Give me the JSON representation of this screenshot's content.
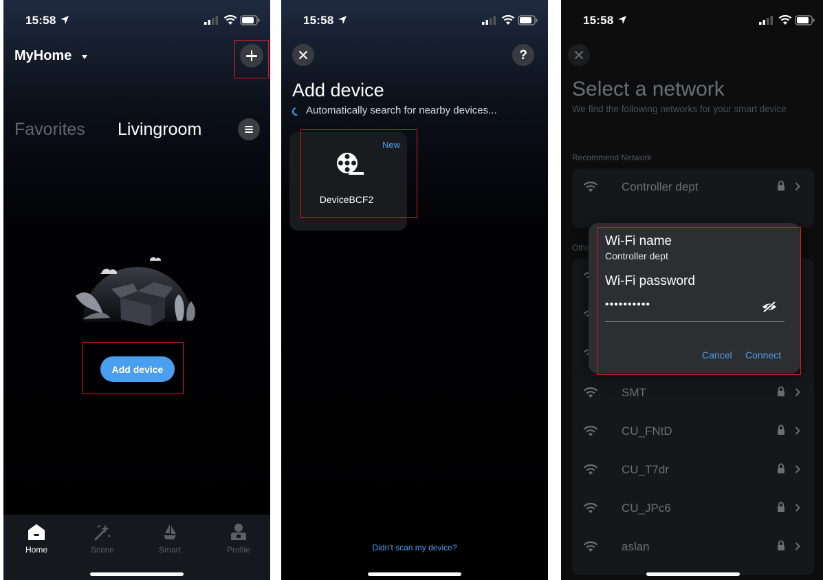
{
  "status": {
    "time": "15:58"
  },
  "home": {
    "title": "MyHome",
    "tabs": {
      "favorites": "Favorites",
      "room": "Livingroom"
    },
    "add_device_label": "Add device",
    "tabbar": [
      {
        "label": "Home",
        "icon": "home-icon"
      },
      {
        "label": "Scene",
        "icon": "magic-wand-icon"
      },
      {
        "label": "Smart",
        "icon": "smart-shapes-icon"
      },
      {
        "label": "Profile",
        "icon": "profile-icon"
      }
    ]
  },
  "add_device": {
    "title": "Add device",
    "searching": "Automatically search for nearby devices...",
    "help": "?",
    "device": {
      "badge": "New",
      "name": "DeviceBCF2",
      "icon": "film-reel-icon"
    },
    "link": "Didn't scan my device?"
  },
  "network": {
    "title": "Select a network",
    "subtitle": "We find the following networks for your smart device",
    "recommend_label": "Recommend Network",
    "others_label": "Othe",
    "recommended": [
      {
        "name": "Controller dept"
      }
    ],
    "others": [
      {
        "name": "SMT"
      },
      {
        "name": "CU_FNtD"
      },
      {
        "name": "CU_T7dr"
      },
      {
        "name": "CU_JPc6"
      },
      {
        "name": "aslan"
      }
    ],
    "dialog": {
      "wifi_name_label": "Wi-Fi name",
      "wifi_name_value": "Controller dept",
      "wifi_password_label": "Wi-Fi password",
      "wifi_password_value": "••••••••••",
      "cancel": "Cancel",
      "connect": "Connect"
    }
  },
  "colors": {
    "accent": "#4a9ff0",
    "highlight": "#e0191f"
  }
}
